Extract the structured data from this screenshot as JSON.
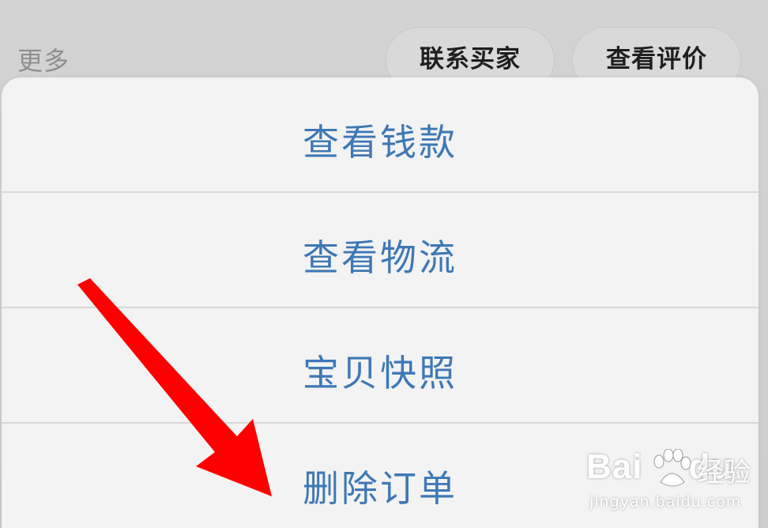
{
  "topbar": {
    "more_label": "更多",
    "contact_seller_label": "联系买家",
    "view_review_label": "查看评价"
  },
  "action_sheet": {
    "items": [
      {
        "label": "查看钱款"
      },
      {
        "label": "查看物流"
      },
      {
        "label": "宝贝快照"
      },
      {
        "label": "删除订单"
      }
    ]
  },
  "annotation": {
    "arrow_color": "#ff0000",
    "target_item": "删除订单"
  },
  "watermark": {
    "logo_text": "Bai",
    "logo_text_end": "du",
    "word": "经验",
    "url": "jingyan.baidu.com"
  },
  "colors": {
    "sheet_text": "#3e78b5",
    "background": "#cfcfcf",
    "sheet_bg": "#f3f3f3"
  }
}
